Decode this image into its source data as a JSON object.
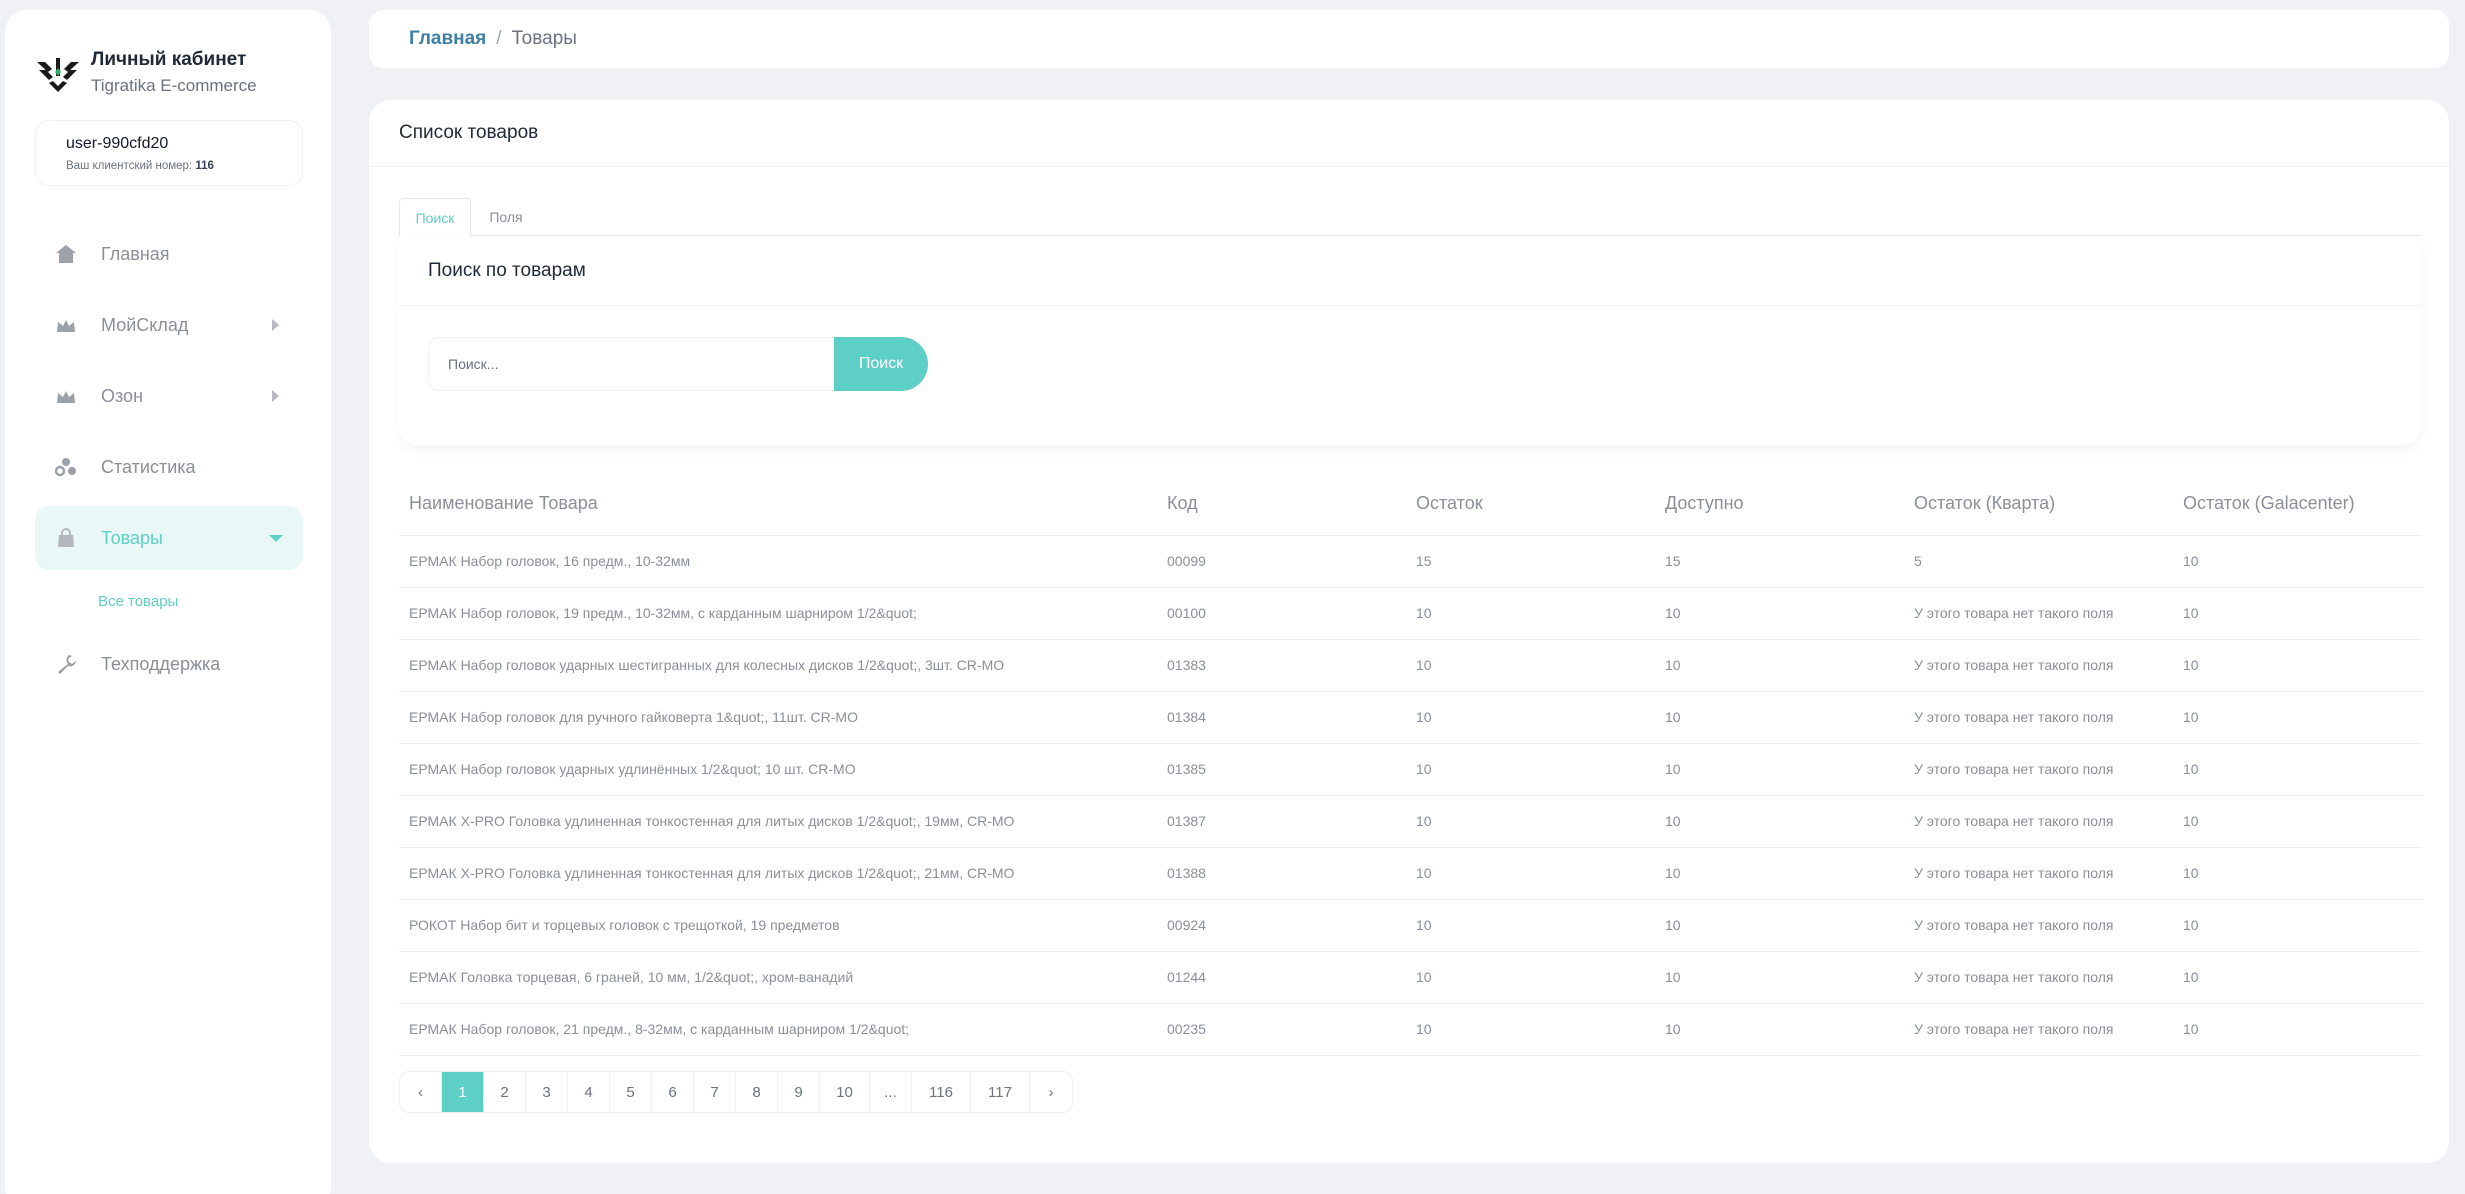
{
  "brand": {
    "title": "Личный кабинет",
    "subtitle": "Tigratika E-commerce"
  },
  "user": {
    "name": "user-990cfd20",
    "client_label": "Ваш клиентский номер:",
    "client_number": "116"
  },
  "sidebar": {
    "items": [
      {
        "label": "Главная",
        "icon": "home-icon",
        "has_arrow": false
      },
      {
        "label": "МойСклад",
        "icon": "crown-icon",
        "has_arrow": true
      },
      {
        "label": "Озон",
        "icon": "crown-icon",
        "has_arrow": true
      },
      {
        "label": "Статистика",
        "icon": "stats-icon",
        "has_arrow": false
      },
      {
        "label": "Товары",
        "icon": "bag-icon",
        "has_arrow": true,
        "active": true
      },
      {
        "label": "Техподдержка",
        "icon": "wrench-icon",
        "has_arrow": false
      }
    ],
    "submenu": {
      "label": "Все товары"
    }
  },
  "breadcrumb": {
    "home": "Главная",
    "separator": "/",
    "current": "Товары"
  },
  "card": {
    "title": "Список товаров"
  },
  "tabs": [
    "Поиск",
    "Поля"
  ],
  "search": {
    "title": "Поиск по товарам",
    "placeholder": "Поиск...",
    "button": "Поиск"
  },
  "table": {
    "headers": [
      "Наименование Товара",
      "Код",
      "Остаток",
      "Доступно",
      "Остаток (Кварта)",
      "Остаток (Galacenter)"
    ],
    "rows": [
      [
        "ЕРМАК Набор головок, 16 предм., 10-32мм",
        "00099",
        "15",
        "15",
        "5",
        "10"
      ],
      [
        "ЕРМАК Набор головок, 19 предм., 10-32мм, с карданным шарниром 1/2&quot;",
        "00100",
        "10",
        "10",
        "У этого товара нет такого поля",
        "10"
      ],
      [
        "ЕРМАК Набор головок ударных шестигранных для колесных дисков 1/2&quot;, 3шт. CR-MO",
        "01383",
        "10",
        "10",
        "У этого товара нет такого поля",
        "10"
      ],
      [
        "ЕРМАК Набор головок для ручного гайковерта 1&quot;, 11шт. CR-MO",
        "01384",
        "10",
        "10",
        "У этого товара нет такого поля",
        "10"
      ],
      [
        "ЕРМАК Набор головок ударных удлинённых 1/2&quot; 10 шт. CR-MO",
        "01385",
        "10",
        "10",
        "У этого товара нет такого поля",
        "10"
      ],
      [
        "ЕРМАК X-PRO Головка удлиненная тонкостенная для литых дисков 1/2&quot;, 19мм, CR-MO",
        "01387",
        "10",
        "10",
        "У этого товара нет такого поля",
        "10"
      ],
      [
        "ЕРМАК X-PRO Головка удлиненная тонкостенная для литых дисков 1/2&quot;, 21мм, CR-MO",
        "01388",
        "10",
        "10",
        "У этого товара нет такого поля",
        "10"
      ],
      [
        "РОКОТ Набор бит и торцевых головок с трещоткой, 19 предметов",
        "00924",
        "10",
        "10",
        "У этого товара нет такого поля",
        "10"
      ],
      [
        "ЕРМАК Головка торцевая, 6 граней, 10 мм, 1/2&quot;, хром-ванадий",
        "01244",
        "10",
        "10",
        "У этого товара нет такого поля",
        "10"
      ],
      [
        "ЕРМАК Набор головок, 21 предм., 8-32мм, с карданным шарниром 1/2&quot;",
        "00235",
        "10",
        "10",
        "У этого товара нет такого поля",
        "10"
      ]
    ]
  },
  "pagination": {
    "prev": "‹",
    "pages": [
      "1",
      "2",
      "3",
      "4",
      "5",
      "6",
      "7",
      "8",
      "9",
      "10",
      "...",
      "116",
      "117"
    ],
    "active": "1",
    "next": "›"
  },
  "colors": {
    "accent": "#5ecfc6",
    "link": "#3f7ea6",
    "background": "#f0f1f4"
  }
}
